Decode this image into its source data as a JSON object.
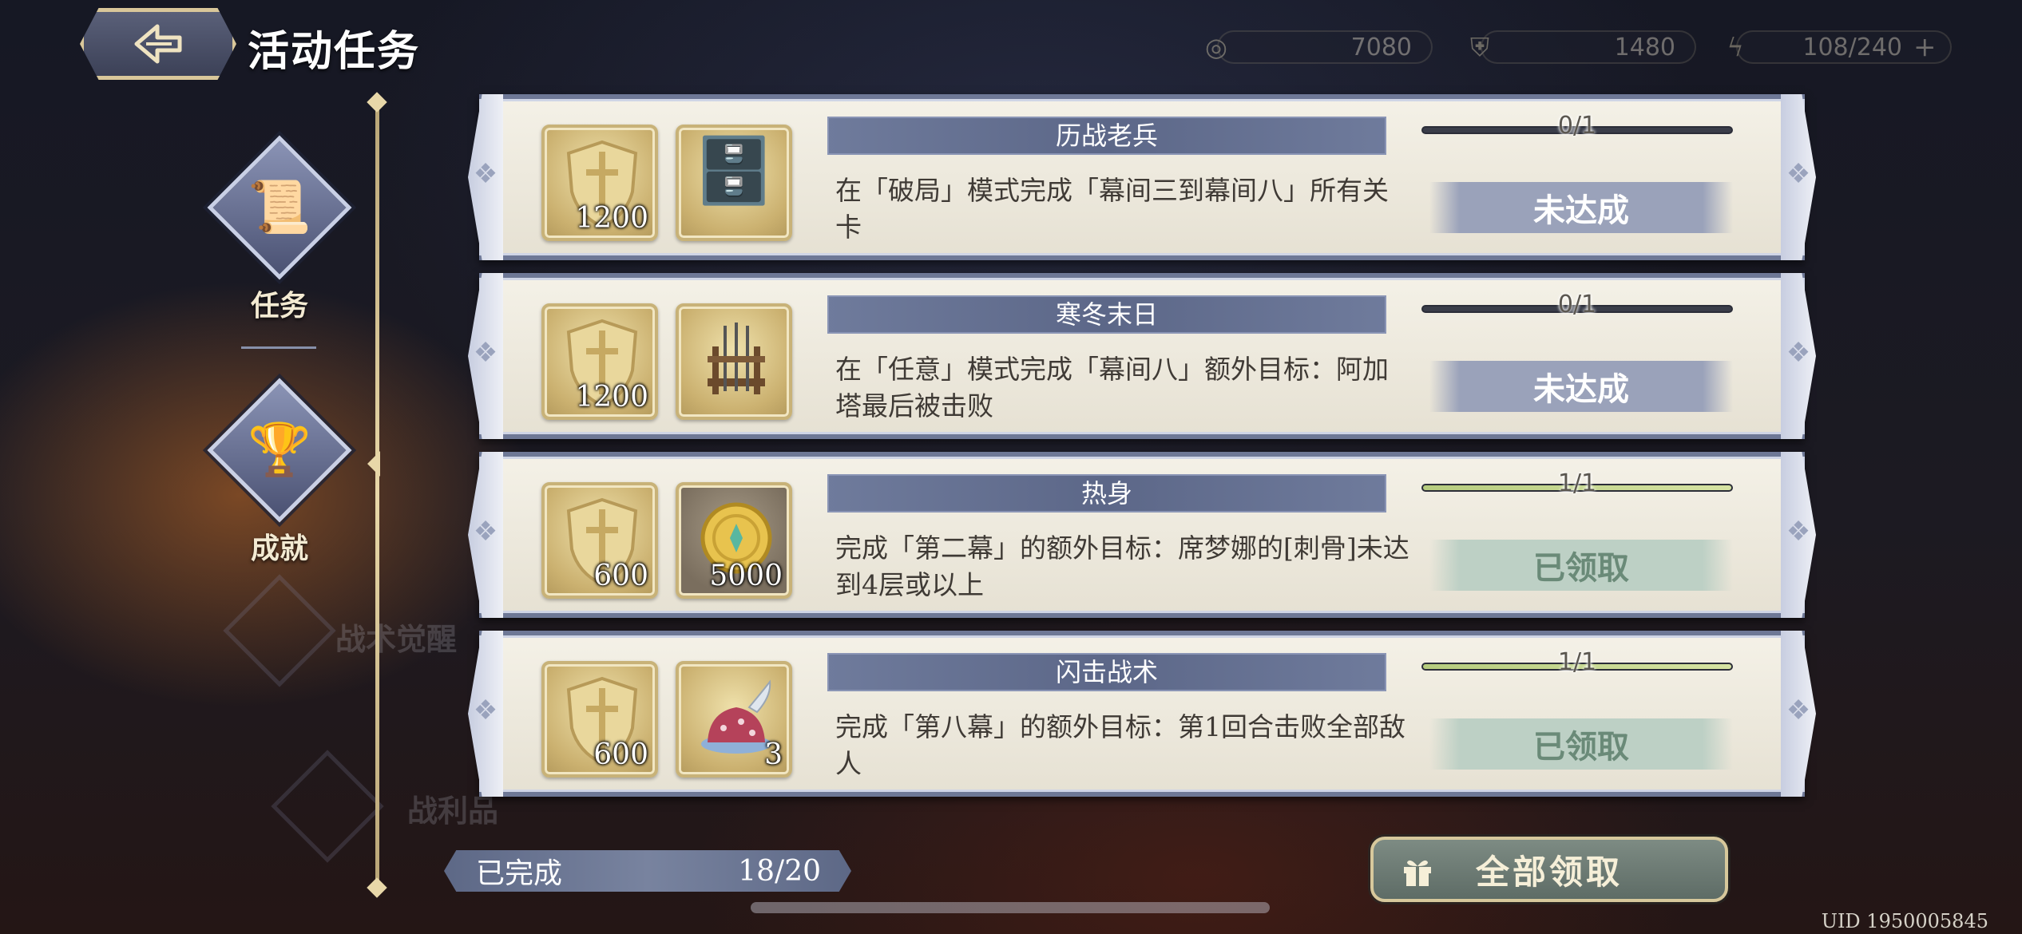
{
  "header": {
    "title": "活动任务"
  },
  "resources": [
    {
      "icon": "coin-icon",
      "value": "7080"
    },
    {
      "icon": "shield-badge-icon",
      "value": "1480"
    },
    {
      "icon": "lightning-icon",
      "value": "108/240",
      "plus": "+"
    }
  ],
  "nav": {
    "items": [
      {
        "label": "任务"
      },
      {
        "label": "成就"
      }
    ]
  },
  "tasks": [
    {
      "name": "历战老兵",
      "description": "在「破局」模式完成「幕间三到幕间八」所有关卡",
      "progress_text": "0/1",
      "progress": 0,
      "status": "未达成",
      "rewards": [
        {
          "icon": "shield-medal-icon",
          "count": "1200"
        },
        {
          "icon": "desk-icon",
          "count": ""
        }
      ]
    },
    {
      "name": "寒冬末日",
      "description": "在「任意」模式完成「幕间八」额外目标：阿加塔最后被击败",
      "progress_text": "0/1",
      "progress": 0,
      "status": "未达成",
      "rewards": [
        {
          "icon": "shield-medal-icon",
          "count": "1200"
        },
        {
          "icon": "weapon-rack-icon",
          "count": ""
        }
      ]
    },
    {
      "name": "热身",
      "description": "完成「第二幕」的额外目标：席梦娜的[刺骨]未达到4层或以上",
      "progress_text": "1/1",
      "progress": 1,
      "status": "已领取",
      "rewards": [
        {
          "icon": "shield-medal-icon",
          "count": "600"
        },
        {
          "icon": "gold-coin-icon",
          "count": "5000"
        }
      ]
    },
    {
      "name": "闪击战术",
      "description": "完成「第八幕」的额外目标：第1回合击败全部敌人",
      "progress_text": "1/1",
      "progress": 1,
      "status": "已领取",
      "rewards": [
        {
          "icon": "shield-medal-icon",
          "count": "600"
        },
        {
          "icon": "cake-icon",
          "count": "3"
        }
      ]
    }
  ],
  "footer": {
    "completed_label": "已完成",
    "completed_value": "18/20",
    "claim_all_label": "全部领取",
    "uid": "UID 1950005845"
  },
  "colors": {
    "pending": "#9aa2ba",
    "claimed": "#bdd0c5",
    "accent_gold": "#d9c79a",
    "title_bar": "#5c6788"
  }
}
